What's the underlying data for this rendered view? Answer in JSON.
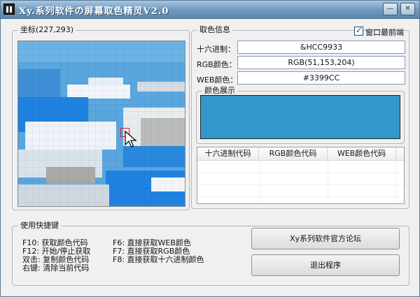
{
  "window": {
    "title": "Xy.系列软件の屏幕取色精灵V2.0",
    "min_glyph": "—",
    "close_glyph": "✕"
  },
  "coords_panel": {
    "label": "坐标(227,293)"
  },
  "color_info": {
    "group_label": "取色信息",
    "on_top_label": "窗口最前端",
    "on_top_checked": true,
    "hex_label": "十六进制：",
    "hex_value": "&HCC9933",
    "rgb_label": "RGB颜色：",
    "rgb_value": "RGB(51,153,204)",
    "web_label": "WEB颜色：",
    "web_value": "#3399CC"
  },
  "color_display": {
    "group_label": "颜色展示",
    "swatch_color": "#3399CC"
  },
  "history_list": {
    "columns": [
      "十六进制代码",
      "RGB颜色代码",
      "WEB颜色代码"
    ]
  },
  "shortcuts": {
    "group_label": "使用快捷键",
    "col1": [
      "F10: 获取颜色代码",
      "F12: 开始/停止获取",
      "双击: 复制颜色代码",
      "右键: 清除当前代码"
    ],
    "col2": [
      "F6: 直接获取WEB颜色",
      "F7: 直接获取RGB颜色",
      "F8: 直接获取十六进制颜色"
    ]
  },
  "buttons": {
    "forum": "Xy系列软件官方论坛",
    "exit": "退出程序"
  }
}
